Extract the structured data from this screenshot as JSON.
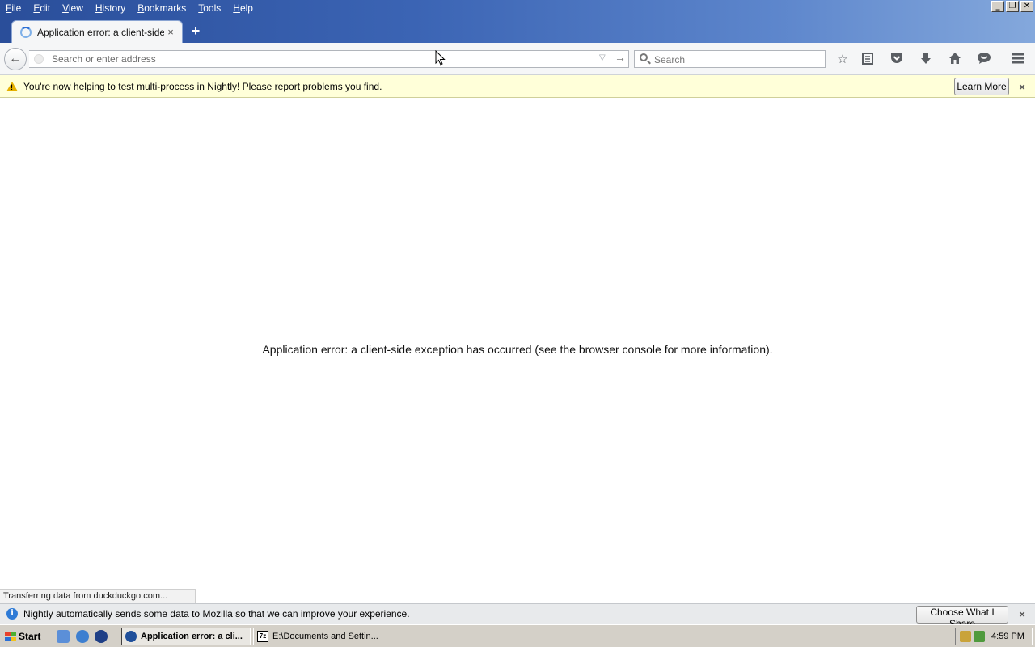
{
  "menu": [
    "File",
    "Edit",
    "View",
    "History",
    "Bookmarks",
    "Tools",
    "Help"
  ],
  "window_controls": {
    "minimize": "_",
    "restore": "❐",
    "close": "✕"
  },
  "tab": {
    "title": "Application error: a client-side...",
    "close": "×"
  },
  "new_tab": "+",
  "navbar": {
    "back": "←",
    "url_placeholder": "Search or enter address",
    "url_value": "",
    "search_placeholder": "Search",
    "icons": [
      "bookmark-star-icon",
      "reading-list-icon",
      "pocket-icon",
      "download-icon",
      "home-icon",
      "chat-icon",
      "menu-icon"
    ]
  },
  "notice": {
    "text": "You're now helping to test multi-process in Nightly! Please report problems you find.",
    "button": "Learn More",
    "close": "×"
  },
  "page": {
    "error_message": "Application error: a client-side exception has occurred (see the browser console for more information)."
  },
  "status": "Transferring data from duckduckgo.com...",
  "bottom_notice": {
    "text": "Nightly automatically sends some data to Mozilla so that we can improve your experience.",
    "button": "Choose What I Share",
    "close": "×"
  },
  "taskbar": {
    "start": "Start",
    "tasks": [
      {
        "label": "Application error: a cli...",
        "active": true
      },
      {
        "label": "E:\\Documents and Settin...",
        "active": false
      }
    ],
    "clock": "4:59 PM"
  },
  "colors": {
    "titlebar": "#2a4e9a",
    "notice_bg": "#ffffd9",
    "taskbar": "#d4d0c8"
  }
}
